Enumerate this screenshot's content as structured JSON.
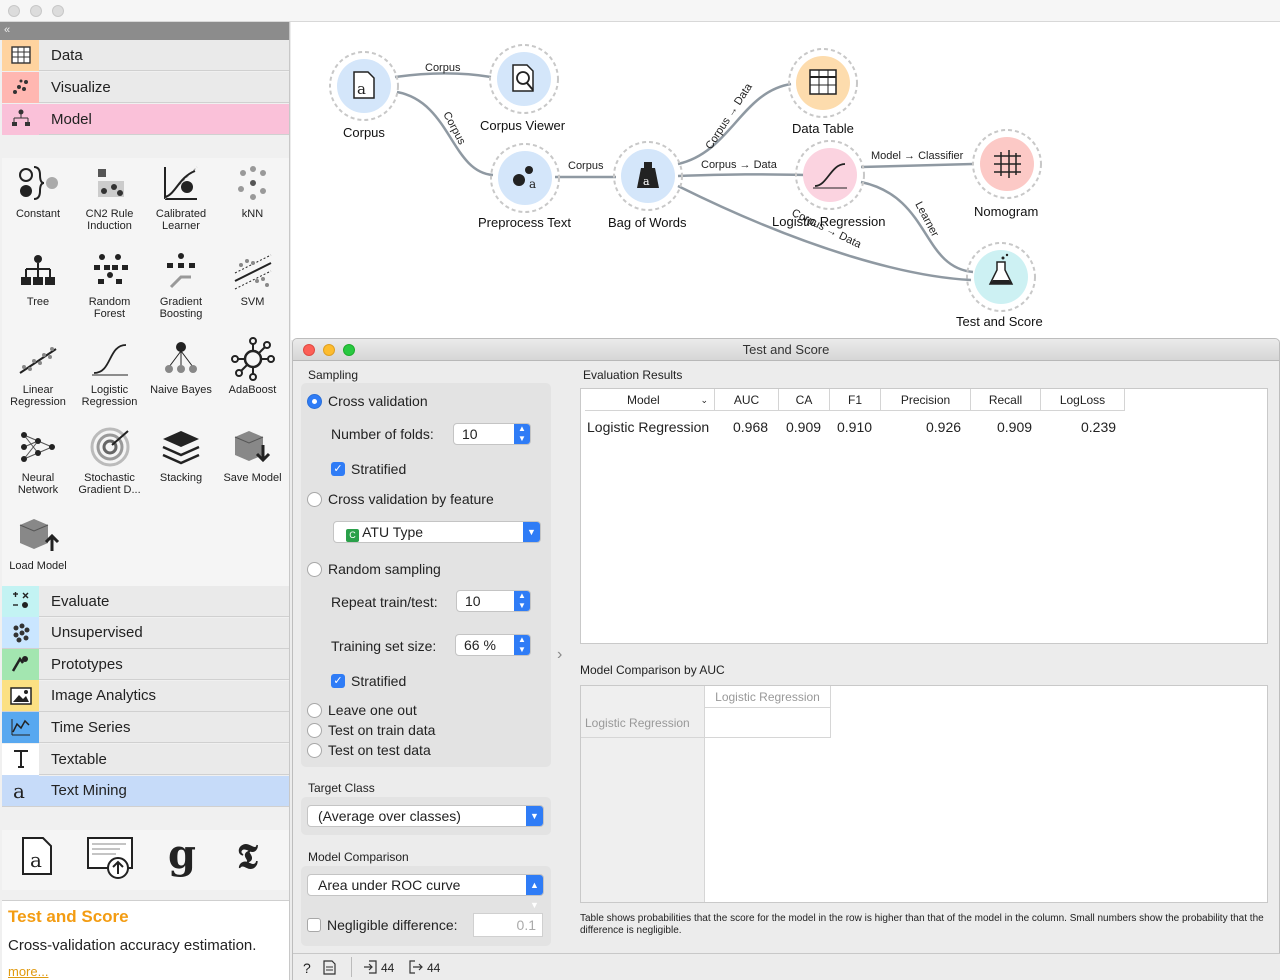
{
  "sidebar": {
    "categories_top": [
      {
        "label": "Data",
        "color": "#ffd39f",
        "icon": "table-icon"
      },
      {
        "label": "Visualize",
        "color": "#ffb7b1",
        "icon": "scatter-icon"
      },
      {
        "label": "Model",
        "color": "#fac1d9",
        "icon": "tree-icon"
      }
    ],
    "widgets": [
      {
        "label": "Constant",
        "icon": "constant-icon"
      },
      {
        "label": "CN2 Rule Induction",
        "icon": "cn2-icon"
      },
      {
        "label": "Calibrated Learner",
        "icon": "calibrated-icon"
      },
      {
        "label": "kNN",
        "icon": "knn-icon"
      },
      {
        "label": "Tree",
        "icon": "tree-icon"
      },
      {
        "label": "Random Forest",
        "icon": "forest-icon"
      },
      {
        "label": "Gradient Boosting",
        "icon": "boosting-icon"
      },
      {
        "label": "SVM",
        "icon": "svm-icon"
      },
      {
        "label": "Linear Regression",
        "icon": "linear-regression-icon"
      },
      {
        "label": "Logistic Regression",
        "icon": "logistic-regression-icon"
      },
      {
        "label": "Naive Bayes",
        "icon": "naive-bayes-icon"
      },
      {
        "label": "AdaBoost",
        "icon": "adaboost-icon"
      },
      {
        "label": "Neural Network",
        "icon": "neural-network-icon"
      },
      {
        "label": "Stochastic Gradient D...",
        "icon": "sgd-icon"
      },
      {
        "label": "Stacking",
        "icon": "stacking-icon"
      },
      {
        "label": "Save Model",
        "icon": "save-model-icon"
      },
      {
        "label": "Load Model",
        "icon": "load-model-icon"
      }
    ],
    "categories_bottom": [
      {
        "label": "Evaluate",
        "color": "#c3f3f3",
        "icon": "evaluate-icon"
      },
      {
        "label": "Unsupervised",
        "color": "#cae6ff",
        "icon": "unsupervised-icon"
      },
      {
        "label": "Prototypes",
        "color": "#a3e6b0",
        "icon": "prototypes-icon"
      },
      {
        "label": "Image Analytics",
        "color": "#fbe083",
        "icon": "image-icon"
      },
      {
        "label": "Time Series",
        "color": "#58a8f0",
        "icon": "time-series-icon"
      },
      {
        "label": "Textable",
        "color": "#ffffff",
        "icon": "textable-icon"
      },
      {
        "label": "Text Mining",
        "color": "#c6dbf9",
        "icon": "text-mining-icon"
      }
    ],
    "text_mining_icons": [
      "corpus-icon",
      "import-documents-icon",
      "guardian-icon",
      "nyt-icon"
    ],
    "info": {
      "title": "Test and Score",
      "description": "Cross-validation accuracy estimation.",
      "more": "more..."
    },
    "collapse_glyph": "«"
  },
  "canvas": {
    "nodes": [
      {
        "id": "corpus",
        "label": "Corpus",
        "color": "#d4e6fa"
      },
      {
        "id": "corpus_viewer",
        "label": "Corpus Viewer",
        "color": "#d4e6fa"
      },
      {
        "id": "preprocess",
        "label": "Preprocess Text",
        "color": "#d4e6fa"
      },
      {
        "id": "bow",
        "label": "Bag of Words",
        "color": "#d4e6fa"
      },
      {
        "id": "data_table",
        "label": "Data Table",
        "color": "#fddcad"
      },
      {
        "id": "logreg",
        "label": "Logistic Regression",
        "color": "#fbd3e0"
      },
      {
        "id": "nomogram",
        "label": "Nomogram",
        "color": "#fcc9c6"
      },
      {
        "id": "test_score",
        "label": "Test and Score",
        "color": "#cdf1f3"
      }
    ],
    "links": {
      "corpus_viewer": "Corpus",
      "corpus_preprocess": "Corpus",
      "preprocess_bow": "Corpus",
      "bow_table": "Corpus → Data",
      "bow_logreg": "Corpus → Data",
      "bow_test": "Corpus → Data",
      "logreg_nomogram": "Model → Classifier",
      "logreg_test": "Learner"
    }
  },
  "dialog": {
    "title": "Test and Score",
    "sampling": {
      "title": "Sampling",
      "cross_validation": "Cross validation",
      "folds_label": "Number of folds:",
      "folds_value": "10",
      "stratified": "Stratified",
      "cv_by_feature": "Cross validation by feature",
      "feature_value": "ATU Type",
      "feature_badge": "C",
      "random_sampling": "Random sampling",
      "repeat_label": "Repeat train/test:",
      "repeat_value": "10",
      "train_size_label": "Training set size:",
      "train_size_value": "66 %",
      "stratified2": "Stratified",
      "leave_one_out": "Leave one out",
      "train_data": "Test on train data",
      "test_data": "Test on test data"
    },
    "target": {
      "title": "Target Class",
      "value": "(Average over classes)"
    },
    "comparison": {
      "title": "Model Comparison",
      "value": "Area under ROC curve",
      "negligible_label": "Negligible difference:",
      "negligible_value": "0.1"
    },
    "results": {
      "title": "Evaluation Results",
      "columns": [
        "Model",
        "AUC",
        "CA",
        "F1",
        "Precision",
        "Recall",
        "LogLoss"
      ],
      "rows": [
        [
          "Logistic Regression",
          "0.968",
          "0.909",
          "0.910",
          "0.926",
          "0.909",
          "0.239"
        ]
      ]
    },
    "model_comparison": {
      "title": "Model Comparison by AUC",
      "column": "Logistic Regression",
      "row": "Logistic Regression"
    },
    "footnote": "Table shows probabilities that the score for the model in the row is higher than that of the model in the column. Small numbers show the probability that the difference is negligible.",
    "status": {
      "input_count": "44",
      "output_count": "44"
    }
  }
}
